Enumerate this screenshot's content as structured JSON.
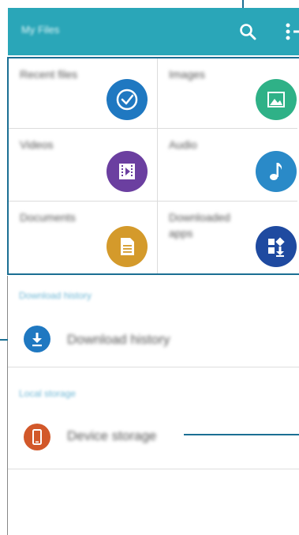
{
  "app_bar": {
    "title": "My Files",
    "search_icon": "search-icon",
    "more_icon": "more-options-icon",
    "color": "#2aa6b8"
  },
  "categories": [
    {
      "label": "Recent files",
      "icon": "clock-check-icon",
      "color": "#1f78c1"
    },
    {
      "label": "Images",
      "icon": "image-icon",
      "color": "#2fb187"
    },
    {
      "label": "Videos",
      "icon": "film-icon",
      "color": "#6b3fa0"
    },
    {
      "label": "Audio",
      "icon": "music-note-icon",
      "color": "#2a8ac8"
    },
    {
      "label": "Documents",
      "icon": "document-icon",
      "color": "#d49a2b"
    },
    {
      "label": "Downloaded apps",
      "icon": "apps-download-icon",
      "color": "#1f4aa0"
    }
  ],
  "download_history": {
    "header": "Download history",
    "item_label": "Download history",
    "icon": "download-icon",
    "color": "#1f78c1"
  },
  "local_storage": {
    "header": "Local storage",
    "item_label": "Device storage",
    "icon": "phone-icon",
    "color": "#d2582a"
  }
}
